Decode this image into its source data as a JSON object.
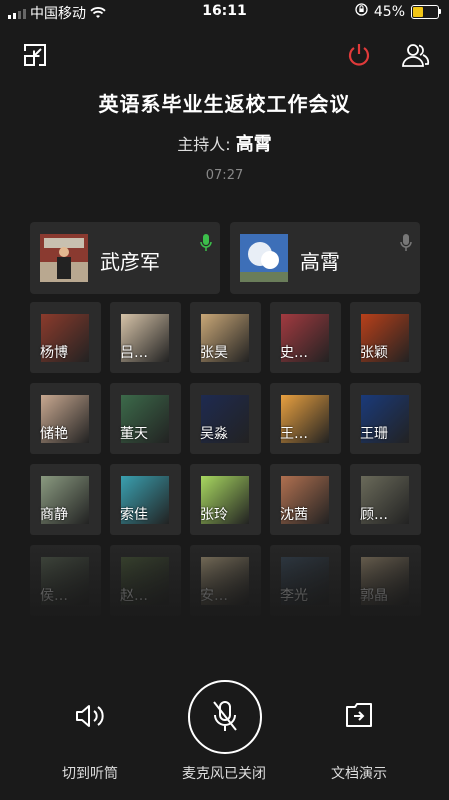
{
  "status_bar": {
    "carrier": "中国移动",
    "time": "16:11",
    "battery": "45%",
    "battery_level": 0.45
  },
  "meeting": {
    "title": "英语系毕业生返校工作会议",
    "host_label": "主持人:",
    "host_name": "高霄",
    "timer": "07:27"
  },
  "speakers": [
    {
      "name": "武彦军",
      "mic": "on"
    },
    {
      "name": "高霄",
      "mic": "off"
    }
  ],
  "participants": [
    "杨博",
    "吕…",
    "张昊",
    "史…",
    "张颖",
    "储艳",
    "董天",
    "吴淼",
    "王…",
    "王珊",
    "商静",
    "索佳",
    "张玲",
    "沈茜",
    "顾…",
    "侯…",
    "赵…",
    "安…",
    "李光",
    "郭晶"
  ],
  "controls": {
    "speaker": "切到听筒",
    "mic": "麦克风已关闭",
    "doc": "文档演示"
  },
  "colors": {
    "background": "#1a1a1a",
    "card": "#2b2b2b",
    "power": "#e03a3a",
    "mic_on": "#3cbf4b",
    "battery": "#f2c617"
  },
  "icons": {
    "shrink": "shrink-window-icon",
    "power": "power-icon",
    "members": "members-icon",
    "speaker": "speaker-icon",
    "mic": "mic-off-icon",
    "doc": "document-share-icon"
  }
}
